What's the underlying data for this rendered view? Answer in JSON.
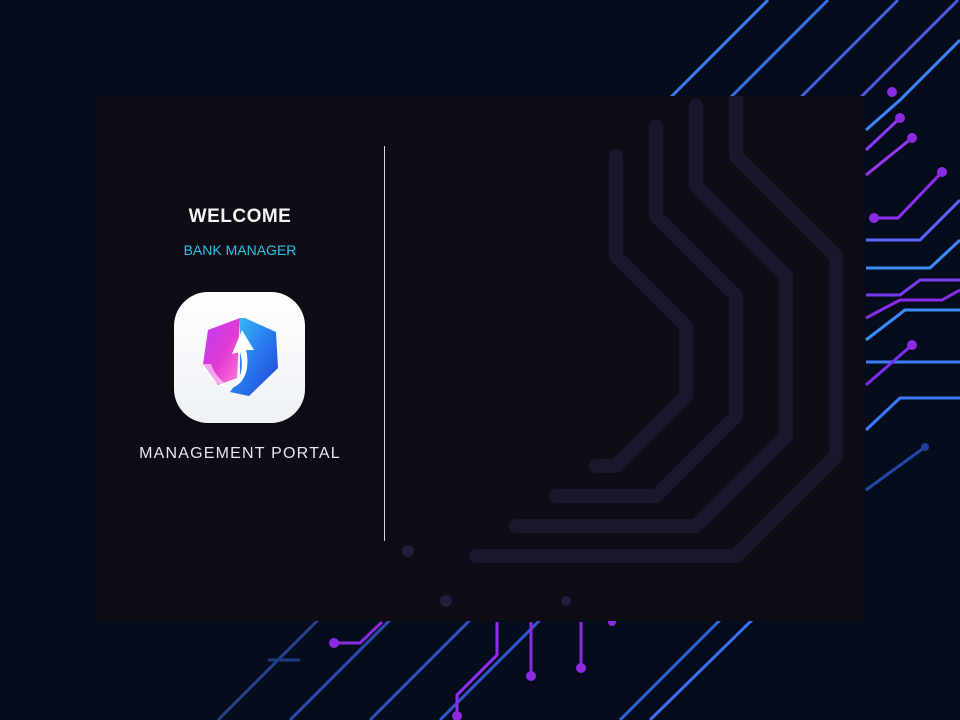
{
  "login": {
    "welcome": "WELCOME",
    "role": "BANK MANAGER",
    "portal": "MANAGEMENT PORTAL"
  },
  "logo": {
    "icon": "arrow-hexagon-logo-icon"
  },
  "colors": {
    "page_background": "#050d1d",
    "card_background": "#0f0c16",
    "accent_cyan": "#27c3ea",
    "circuit_blue": "#2f6bff",
    "circuit_purple": "#8a2be2",
    "divider": "#d6d6dc"
  }
}
